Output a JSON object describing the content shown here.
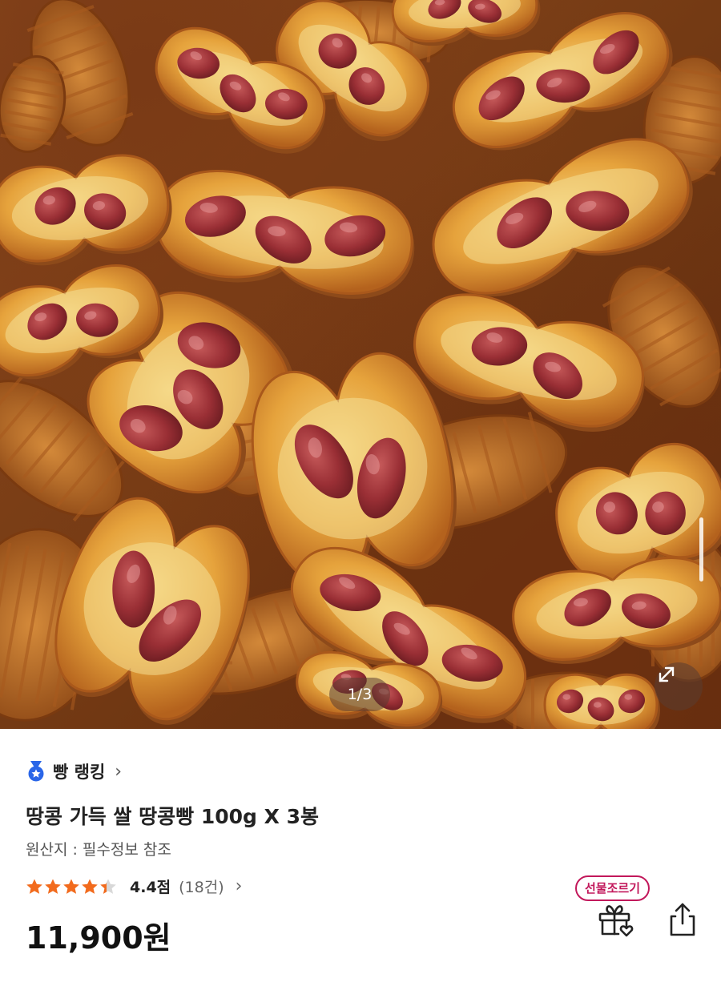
{
  "gallery": {
    "counter": "1/3",
    "current": 1,
    "total": 3
  },
  "ranking": {
    "label": "빵 랭킹",
    "chevron": "›",
    "icon": "medal-icon",
    "icon_color": "#2a66e8"
  },
  "product": {
    "title": "땅콩 가득 쌀 땅콩빵 100g X 3봉",
    "origin": "원산지 : 필수정보 참조",
    "rating_value": 4.4,
    "rating_max": 5,
    "rating_text": "4.4점",
    "review_count": "(18건)",
    "price": "11,900원"
  },
  "actions": {
    "gift_badge": "선물조르기",
    "gift_icon": "gift-icon",
    "share_icon": "share-icon",
    "expand_icon": "expand-icon"
  },
  "colors": {
    "star": "#f26b1d",
    "star_empty": "#d8d8d8",
    "gift_accent": "#c2185b"
  }
}
